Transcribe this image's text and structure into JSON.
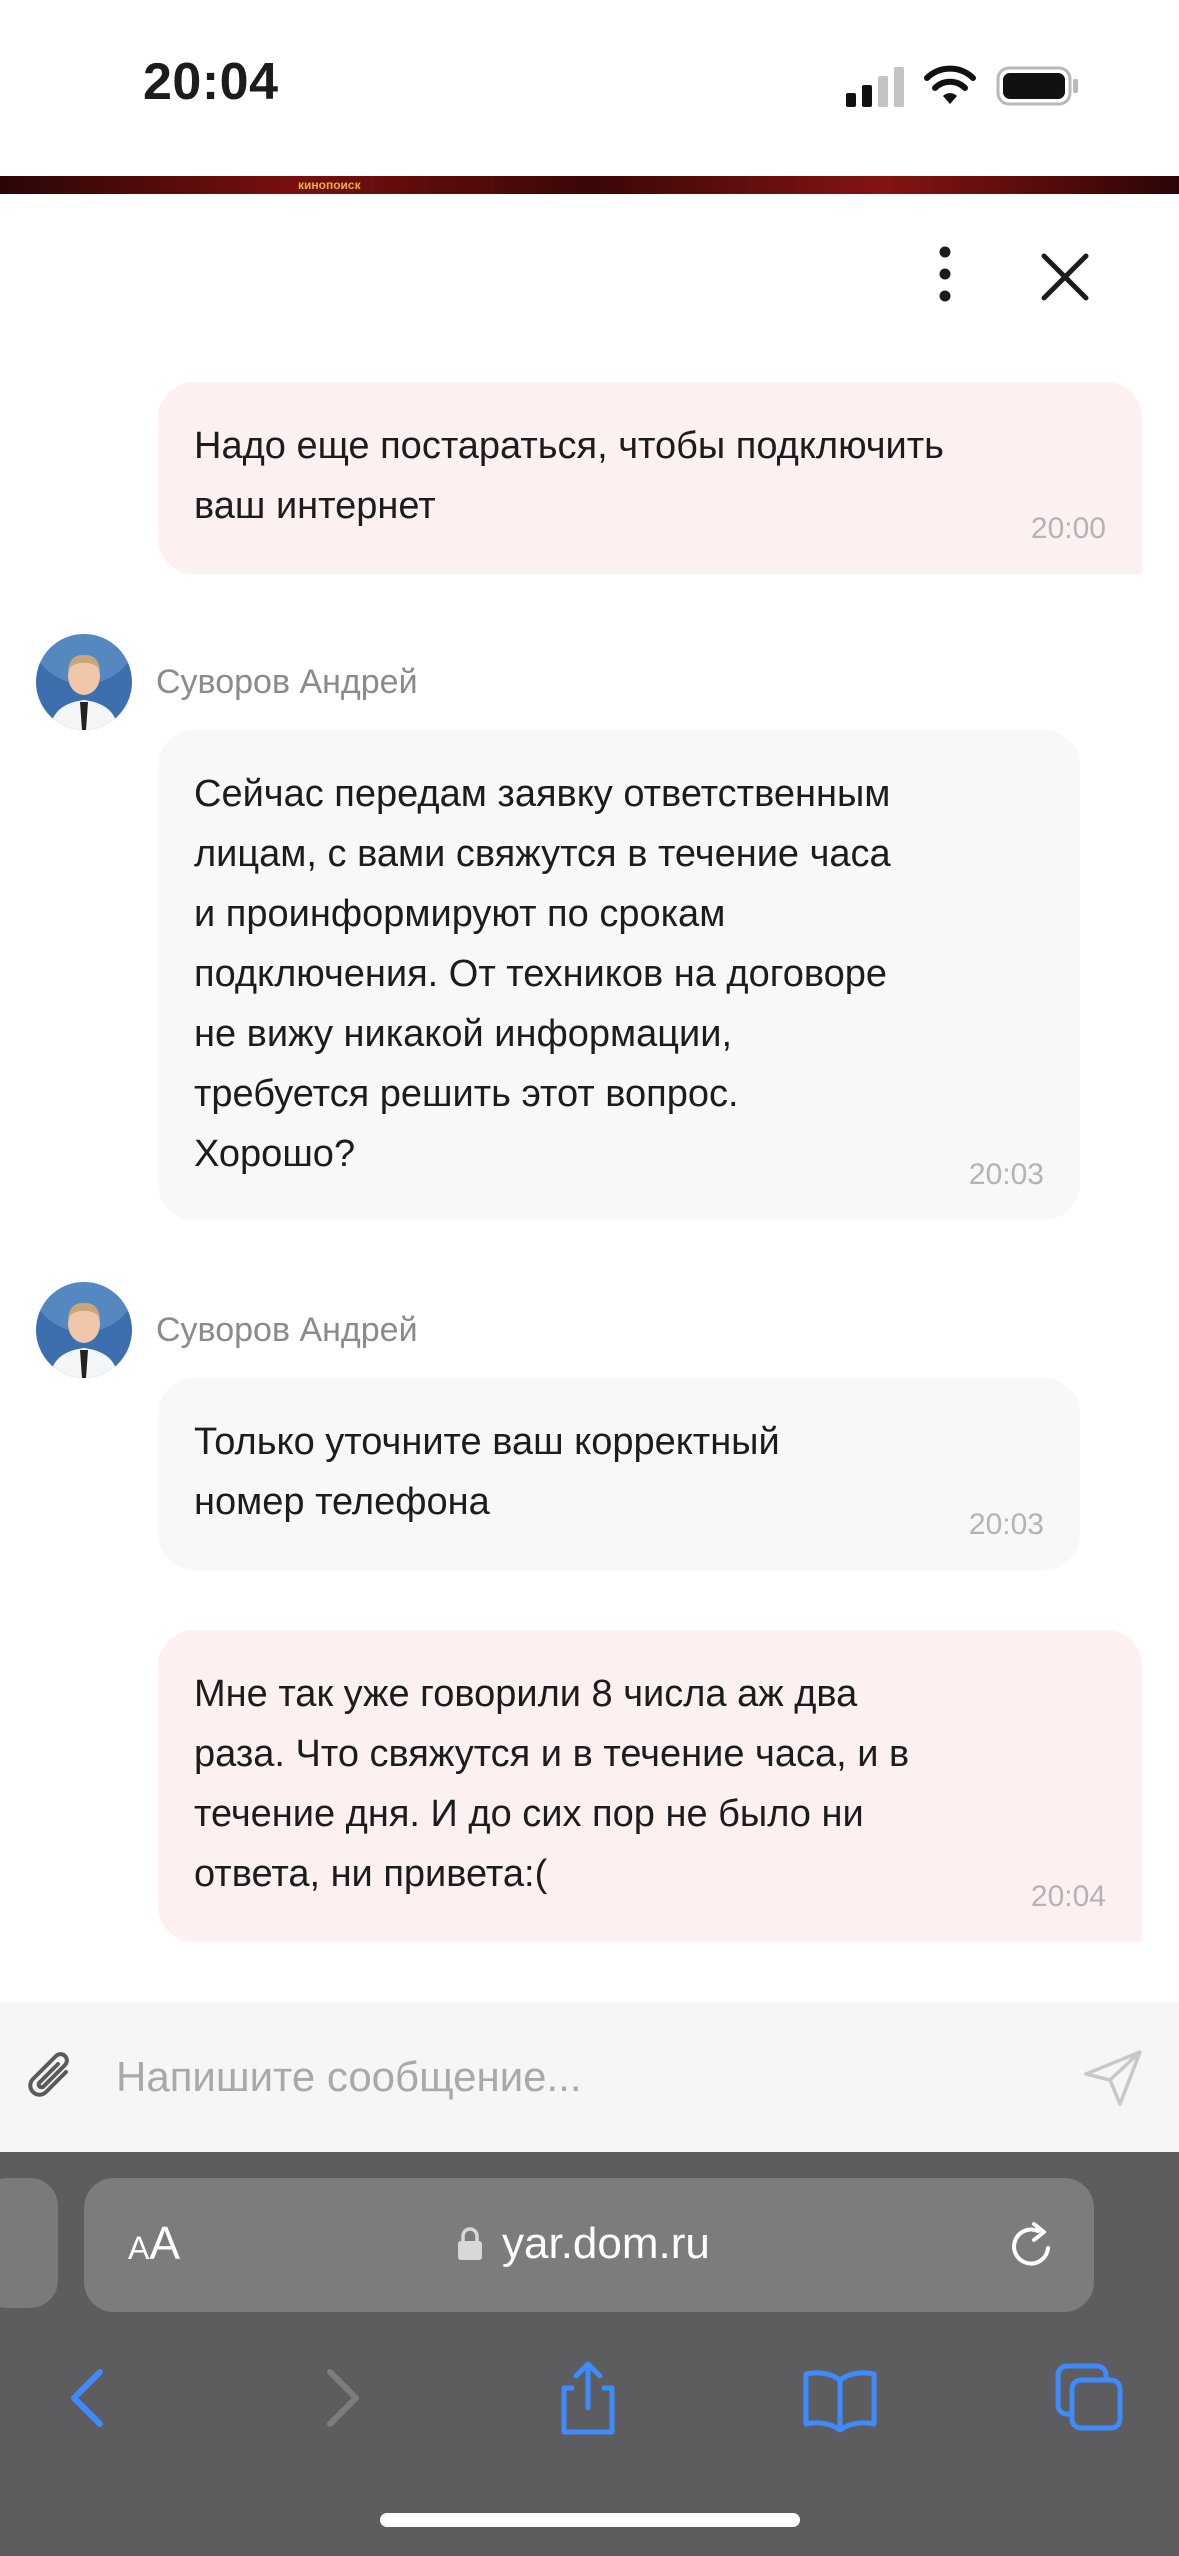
{
  "status_bar": {
    "time": "20:04"
  },
  "banner": {
    "text": "кинопоиск"
  },
  "header": {
    "more_icon": "more-vertical-icon",
    "close_icon": "close-icon"
  },
  "messages": [
    {
      "direction": "outgoing",
      "text": "Надо еще постараться, чтобы подключить\nваш интернет",
      "time": "20:00"
    },
    {
      "direction": "incoming",
      "sender": "Суворов Андрей",
      "text": "Сейчас передам заявку ответственным\nлицам, с вами свяжутся в течение часа\nи проинформируют по срокам\nподключения. От техников на договоре\nне вижу никакой информации,\nтребуется решить этот вопрос.\nХорошо?",
      "time": "20:03"
    },
    {
      "direction": "incoming",
      "sender": "Суворов Андрей",
      "text": "Только уточните ваш корректный\nномер телефона",
      "time": "20:03"
    },
    {
      "direction": "outgoing",
      "text": "Мне так уже говорили 8 числа аж два\nраза. Что свяжутся и в течение часа, и в\nтечение дня. И до сих пор не было ни\nответа, ни привета:(",
      "time": "20:04"
    }
  ],
  "composer": {
    "placeholder": "Напишите сообщение...",
    "value": ""
  },
  "browser": {
    "text_size_small": "A",
    "text_size_big": "A",
    "url": "yar.dom.ru"
  },
  "colors": {
    "outgoing_bubble": "#fcf0f1",
    "incoming_bubble": "#f8f8f8",
    "safari_toolbar": "#5d5d5f",
    "safari_accent": "#3d8bfd"
  }
}
